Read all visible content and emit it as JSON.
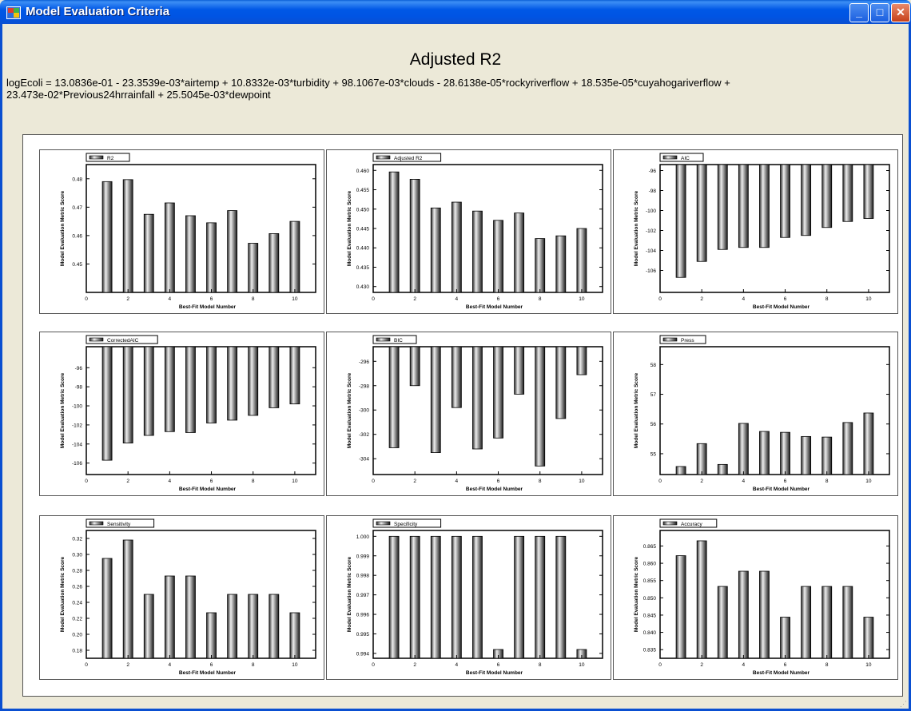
{
  "window": {
    "title": "Model Evaluation Criteria"
  },
  "window_buttons": {
    "minimize": "_",
    "maximize": "□",
    "close": "✕"
  },
  "heading": "Adjusted R2",
  "equation_line1": "logEcoli = 13.0836e-01 - 23.3539e-03*airtemp + 10.8332e-03*turbidity + 98.1067e-03*clouds - 28.6138e-05*rockyriverflow + 18.535e-05*cuyahogariverflow +",
  "equation_line2": "23.473e-02*Previous24hrrainfall + 25.5045e-03*dewpoint",
  "chart_data": [
    {
      "type": "bar",
      "legend": "R2",
      "xlabel": "Best-Fit Model Number",
      "ylabel": "Model Evaluation Metric Score",
      "x": [
        1,
        2,
        3,
        4,
        5,
        6,
        7,
        8,
        9,
        10
      ],
      "values": [
        0.479,
        0.4797,
        0.4675,
        0.4715,
        0.467,
        0.4645,
        0.4688,
        0.4573,
        0.4607,
        0.465
      ],
      "ylim": [
        0.44,
        0.485
      ],
      "yticks": [
        0.45,
        0.46,
        0.47,
        0.48
      ],
      "xlim": [
        0,
        11
      ],
      "xticks": [
        0,
        2,
        4,
        6,
        8,
        10
      ],
      "baseline": "bottom"
    },
    {
      "type": "bar",
      "legend": "Adjusted R2",
      "xlabel": "Best-Fit Model Number",
      "ylabel": "Model Evaluation Metric Score",
      "x": [
        1,
        2,
        3,
        4,
        5,
        6,
        7,
        8,
        9,
        10
      ],
      "values": [
        0.4596,
        0.4577,
        0.4503,
        0.4518,
        0.4495,
        0.4471,
        0.449,
        0.4424,
        0.4431,
        0.445
      ],
      "ylim": [
        0.4285,
        0.4615
      ],
      "yticks": [
        0.43,
        0.435,
        0.44,
        0.445,
        0.45,
        0.455,
        0.46
      ],
      "xlim": [
        0,
        11
      ],
      "xticks": [
        0,
        2,
        4,
        6,
        8,
        10
      ],
      "baseline": "bottom"
    },
    {
      "type": "bar",
      "legend": "AIC",
      "xlabel": "Best-Fit Model Number",
      "ylabel": "Model Evaluation Metric Score",
      "x": [
        1,
        2,
        3,
        4,
        5,
        6,
        7,
        8,
        9,
        10
      ],
      "values": [
        -106.7,
        -105.1,
        -103.9,
        -103.7,
        -103.7,
        -102.7,
        -102.5,
        -101.7,
        -101.1,
        -100.8
      ],
      "ylim": [
        -108.2,
        -95.4
      ],
      "yticks": [
        -96,
        -98,
        -100,
        -102,
        -104,
        -106
      ],
      "xlim": [
        0,
        11
      ],
      "xticks": [
        0,
        2,
        4,
        6,
        8,
        10
      ],
      "baseline": "top"
    },
    {
      "type": "bar",
      "legend": "CorrectedAIC",
      "xlabel": "Best-Fit Model Number",
      "ylabel": "Model Evaluation Metric Score",
      "x": [
        1,
        2,
        3,
        4,
        5,
        6,
        7,
        8,
        9,
        10
      ],
      "values": [
        -105.7,
        -103.9,
        -103.1,
        -102.7,
        -102.8,
        -101.8,
        -101.5,
        -101.0,
        -100.2,
        -99.8
      ],
      "ylim": [
        -107.2,
        -93.8
      ],
      "yticks": [
        -96,
        -98,
        -100,
        -102,
        -104,
        -106
      ],
      "xlim": [
        0,
        11
      ],
      "xticks": [
        0,
        2,
        4,
        6,
        8,
        10
      ],
      "baseline": "top"
    },
    {
      "type": "bar",
      "legend": "BIC",
      "xlabel": "Best-Fit Model Number",
      "ylabel": "Model Evaluation Metric Score",
      "x": [
        1,
        2,
        3,
        4,
        5,
        6,
        7,
        8,
        9,
        10
      ],
      "values": [
        -303.1,
        -298.0,
        -303.5,
        -299.8,
        -303.2,
        -302.3,
        -298.7,
        -304.6,
        -300.7,
        -297.1
      ],
      "ylim": [
        -305.3,
        -294.8
      ],
      "yticks": [
        -296,
        -298,
        -300,
        -302,
        -304
      ],
      "xlim": [
        0,
        11
      ],
      "xticks": [
        0,
        2,
        4,
        6,
        8,
        10
      ],
      "baseline": "top"
    },
    {
      "type": "bar",
      "legend": "Press",
      "xlabel": "Best-Fit Model Number",
      "ylabel": "Model Evaluation Metric Score",
      "x": [
        1,
        2,
        3,
        4,
        5,
        6,
        7,
        8,
        9,
        10
      ],
      "values": [
        54.57,
        55.34,
        54.64,
        56.02,
        55.75,
        55.72,
        55.58,
        55.56,
        56.05,
        56.37
      ],
      "ylim": [
        54.3,
        58.6
      ],
      "yticks": [
        55,
        56,
        57,
        58
      ],
      "xlim": [
        0,
        11
      ],
      "xticks": [
        0,
        2,
        4,
        6,
        8,
        10
      ],
      "baseline": "bottom"
    },
    {
      "type": "bar",
      "legend": "Sensitivity",
      "xlabel": "Best-Fit Model Number",
      "ylabel": "Model Evaluation Metric Score",
      "x": [
        1,
        2,
        3,
        4,
        5,
        6,
        7,
        8,
        9,
        10
      ],
      "values": [
        0.295,
        0.318,
        0.25,
        0.273,
        0.273,
        0.227,
        0.25,
        0.25,
        0.25,
        0.227
      ],
      "ylim": [
        0.17,
        0.33
      ],
      "yticks": [
        0.18,
        0.2,
        0.22,
        0.24,
        0.26,
        0.28,
        0.3,
        0.32
      ],
      "xlim": [
        0,
        11
      ],
      "xticks": [
        0,
        2,
        4,
        6,
        8,
        10
      ],
      "baseline": "bottom"
    },
    {
      "type": "bar",
      "legend": "Specificity",
      "xlabel": "Best-Fit Model Number",
      "ylabel": "Model Evaluation Metric Score",
      "x": [
        1,
        2,
        3,
        4,
        5,
        6,
        7,
        8,
        9,
        10
      ],
      "values": [
        1.0,
        1.0,
        1.0,
        1.0,
        1.0,
        0.9942,
        1.0,
        1.0,
        1.0,
        0.9942
      ],
      "ylim": [
        0.99375,
        1.0003
      ],
      "yticks": [
        0.994,
        0.995,
        0.996,
        0.997,
        0.998,
        0.999,
        1.0
      ],
      "xlim": [
        0,
        11
      ],
      "xticks": [
        0,
        2,
        4,
        6,
        8,
        10
      ],
      "baseline": "bottom"
    },
    {
      "type": "bar",
      "legend": "Accuracy",
      "xlabel": "Best-Fit Model Number",
      "ylabel": "Model Evaluation Metric Score",
      "x": [
        1,
        2,
        3,
        4,
        5,
        6,
        7,
        8,
        9,
        10
      ],
      "values": [
        0.8622,
        0.8665,
        0.8533,
        0.8577,
        0.8577,
        0.8444,
        0.8533,
        0.8533,
        0.8533,
        0.8444
      ],
      "ylim": [
        0.8325,
        0.8695
      ],
      "yticks": [
        0.835,
        0.84,
        0.845,
        0.85,
        0.855,
        0.86,
        0.865
      ],
      "xlim": [
        0,
        11
      ],
      "xticks": [
        0,
        2,
        4,
        6,
        8,
        10
      ],
      "baseline": "bottom"
    }
  ]
}
